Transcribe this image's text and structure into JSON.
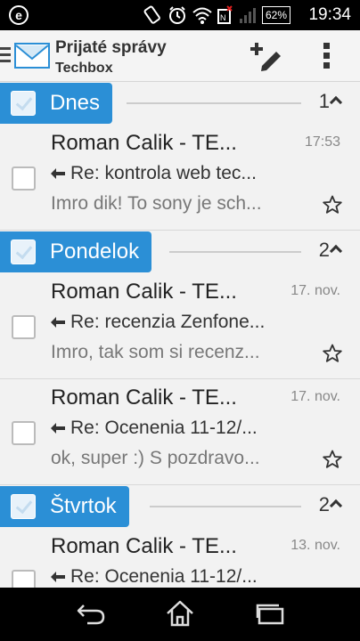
{
  "status_bar": {
    "app_icon_letter": "e",
    "battery": "62%",
    "time": "19:34",
    "icons": [
      "e-app-icon",
      "rotate-icon",
      "alarm-icon",
      "wifi-icon",
      "nfc-icon",
      "signal-icon",
      "battery-icon"
    ]
  },
  "action_bar": {
    "title": "Prijaté správy",
    "subtitle": "Techbox",
    "icons": [
      "menu-icon",
      "envelope-icon",
      "compose-icon",
      "overflow-menu-icon"
    ]
  },
  "sections": [
    {
      "label": "Dnes",
      "count": "1"
    },
    {
      "label": "Pondelok",
      "count": "2"
    },
    {
      "label": "Štvrtok",
      "count": "2"
    }
  ],
  "emails": [
    {
      "sender": "Roman Calik - TE...",
      "date": "17:53",
      "subject": "Re: kontrola web tec...",
      "preview": "Imro dik! To sony je sch..."
    },
    {
      "sender": "Roman Calik - TE...",
      "date": "17. nov.",
      "subject": "Re: recenzia Zenfone...",
      "preview": "Imro, tak som si recenz..."
    },
    {
      "sender": "Roman Calik - TE...",
      "date": "17. nov.",
      "subject": "Re: Ocenenia 11-12/...",
      "preview": "ok, super :) S pozdravo..."
    },
    {
      "sender": "Roman Calik - TE...",
      "date": "13. nov.",
      "subject": "Re: Ocenenia 11-12/...",
      "preview": ""
    }
  ],
  "nav_bar": {
    "icons": [
      "back-icon",
      "home-icon",
      "recent-apps-icon"
    ]
  },
  "colors": {
    "accent": "#2b8fd6",
    "status_bar": "#000000",
    "background": "#f2f2f2"
  }
}
